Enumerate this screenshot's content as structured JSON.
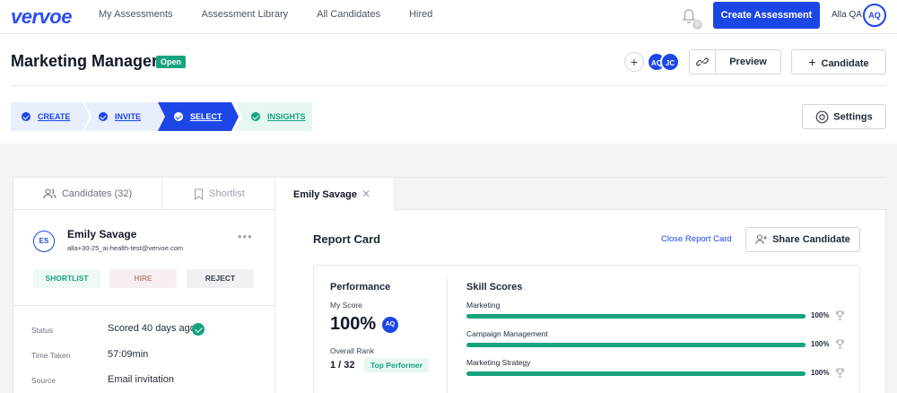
{
  "brand": {
    "logo": "vervoe",
    "primary": "#1d46e6",
    "green": "#16a37f"
  },
  "nav": {
    "links": [
      "My Assessments",
      "Assessment Library",
      "All Candidates",
      "Hired"
    ],
    "notification_count": "0",
    "create_label": "Create Assessment",
    "user_name": "Alla QA",
    "user_initials": "AQ"
  },
  "header": {
    "title": "Marketing Manager",
    "status": "Open",
    "collaborators": [
      "AQ",
      "JC"
    ],
    "preview_label": "Preview",
    "candidate_label": "Candidate"
  },
  "steps": [
    "CREATE",
    "INVITE",
    "SELECT",
    "INSIGHTS"
  ],
  "settings_label": "Settings",
  "left": {
    "tabs": {
      "candidates": "Candidates (32)",
      "shortlist": "Shortlist"
    },
    "candidate": {
      "initials": "ES",
      "name": "Emily Savage",
      "email": "alla+30-25_ai-health-test@vervoe.com"
    },
    "actions": {
      "shortlist": "SHORTLIST",
      "hire": "HIRE",
      "reject": "REJECT"
    },
    "info": [
      {
        "label": "Status",
        "value": "Scored 40 days ago"
      },
      {
        "label": "Time Taken",
        "value": "57:09min"
      },
      {
        "label": "Source",
        "value": "Email invitation"
      }
    ]
  },
  "right": {
    "tab_label": "Emily Savage",
    "title": "Report Card",
    "close_label": "Close Report Card",
    "share_label": "Share Candidate",
    "performance": {
      "title": "Performance",
      "score_label": "My Score",
      "score_value": "100%",
      "score_initials": "AQ",
      "rank_label": "Overall Rank",
      "rank_value": "1 / 32",
      "rank_badge": "Top Performer"
    },
    "skills_title": "Skill Scores",
    "skills": [
      {
        "name": "Marketing",
        "pct_label": "100%",
        "pct": 100
      },
      {
        "name": "Campaign Management",
        "pct_label": "100%",
        "pct": 100
      },
      {
        "name": "Marketing Strategy",
        "pct_label": "100%",
        "pct": 100
      }
    ]
  }
}
